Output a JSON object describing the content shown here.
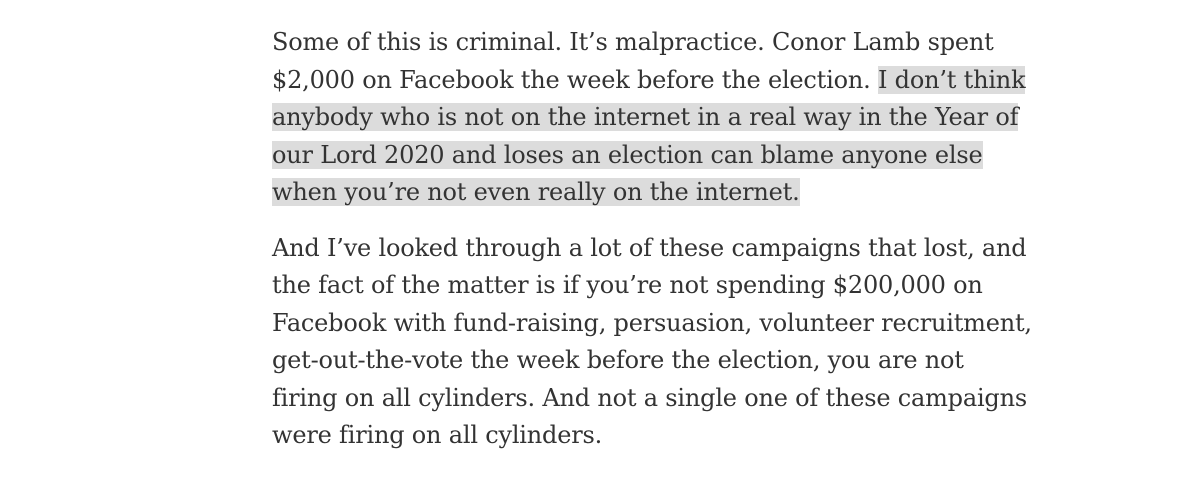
{
  "article": {
    "para1": {
      "normal": "Some of this is criminal. It’s malpractice. Conor Lamb spent $2,000 on Facebook the week before the election. ",
      "highlighted": "I don’t think anybody who is not on the internet in a real way in the Year of our Lord 2020 and loses an election can blame anyone else when you’re not even really on the internet."
    },
    "para2": "And I’ve looked through a lot of these campaigns that lost, and the fact of the matter is if you’re not spending $200,000 on Facebook with fund-raising, persuasion, volunteer recruitment, get-out-the-vote the week before the election, you are not firing on all cylinders. And not a single one of these campaigns were firing on all cylinders."
  },
  "colors": {
    "text": "#333333",
    "highlight": "#dcdcdc",
    "background": "#ffffff"
  }
}
